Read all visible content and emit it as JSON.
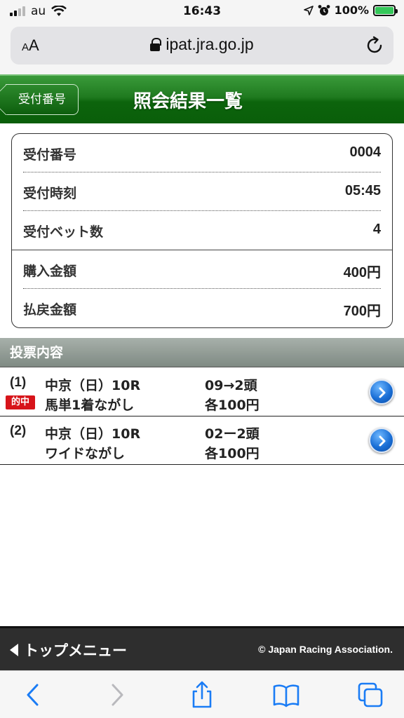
{
  "status_bar": {
    "carrier": "au",
    "time": "16:43",
    "battery": "100%",
    "battery_level": 1.0,
    "signal_bars_active": 2,
    "signal_bars_total": 4
  },
  "browser": {
    "aa_label_small": "A",
    "aa_label_big": "A",
    "url": "ipat.jra.go.jp"
  },
  "header": {
    "back_label": "受付番号",
    "title": "照会結果一覧"
  },
  "receipt": {
    "rows": [
      {
        "label": "受付番号",
        "value": "0004"
      },
      {
        "label": "受付時刻",
        "value": "05:45"
      },
      {
        "label": "受付ベット数",
        "value": "4"
      },
      {
        "label": "購入金額",
        "value": "400円"
      },
      {
        "label": "払戻金額",
        "value": "700円"
      }
    ]
  },
  "bets": {
    "section_title": "投票内容",
    "items": [
      {
        "num": "(1)",
        "hit_label": "的中",
        "race": "中京（日）10R",
        "type": "馬単1着ながし",
        "combo": "09→2頭",
        "amount": "各100円"
      },
      {
        "num": "(2)",
        "hit_label": "",
        "race": "中京（日）10R",
        "type": "ワイドながし",
        "combo": "02ー2頭",
        "amount": "各100円"
      }
    ]
  },
  "footer": {
    "top_menu_label": "トップメニュー",
    "copyright": "© Japan Racing Association."
  },
  "colors": {
    "header_green": "#1f7a1f",
    "hit_red": "#d7141a",
    "ios_blue": "#1a7cf5"
  }
}
